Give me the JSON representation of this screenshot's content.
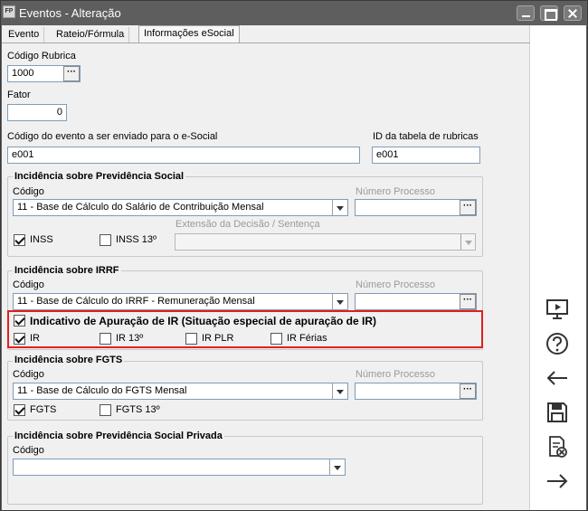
{
  "window": {
    "title": "Eventos - Alteração",
    "app_icon_text": "FP"
  },
  "tabs": [
    {
      "label": "Evento"
    },
    {
      "label": "Rateio/Fórmula"
    },
    {
      "label": "Informações eSocial"
    }
  ],
  "fields": {
    "codigo_rubrica_label": "Código Rubrica",
    "codigo_rubrica_value": "1000",
    "fator_label": "Fator",
    "fator_value": "0",
    "codigo_evento_label": "Código do evento a ser enviado para o e-Social",
    "codigo_evento_value": "e001",
    "id_tabela_label": "ID da tabela de rubricas",
    "id_tabela_value": "e001",
    "dots": "···"
  },
  "previdencia": {
    "title": "Incidência sobre Previdência Social",
    "codigo_label": "Código",
    "codigo_value": "11 - Base de Cálculo do Salário de Contribuição Mensal",
    "numero_processo_label": "Número Processo",
    "extensao_label": "Extensão da Decisão / Sentença",
    "inss_label": "INSS",
    "inss13_label": "INSS 13º"
  },
  "irrf": {
    "title": "Incidência sobre IRRF",
    "codigo_label": "Código",
    "codigo_value": "11 - Base de Cálculo do IRRF - Remuneração Mensal",
    "numero_processo_label": "Número Processo",
    "indicativo_label": "Indicativo de Apuração de IR (Situação especial de apuração de IR)",
    "ir_label": "IR",
    "ir13_label": "IR 13º",
    "irplr_label": "IR PLR",
    "irferias_label": "IR Férias"
  },
  "fgts": {
    "title": "Incidência sobre FGTS",
    "codigo_label": "Código",
    "codigo_value": "11 - Base de Cálculo do FGTS Mensal",
    "numero_processo_label": "Número Processo",
    "fgts_label": "FGTS",
    "fgts13_label": "FGTS 13º"
  },
  "previdencia_privada": {
    "title": "Incidência sobre Previdência Social Privada",
    "codigo_label": "Código",
    "codigo_value": ""
  },
  "highlight_color": "#e0201c"
}
